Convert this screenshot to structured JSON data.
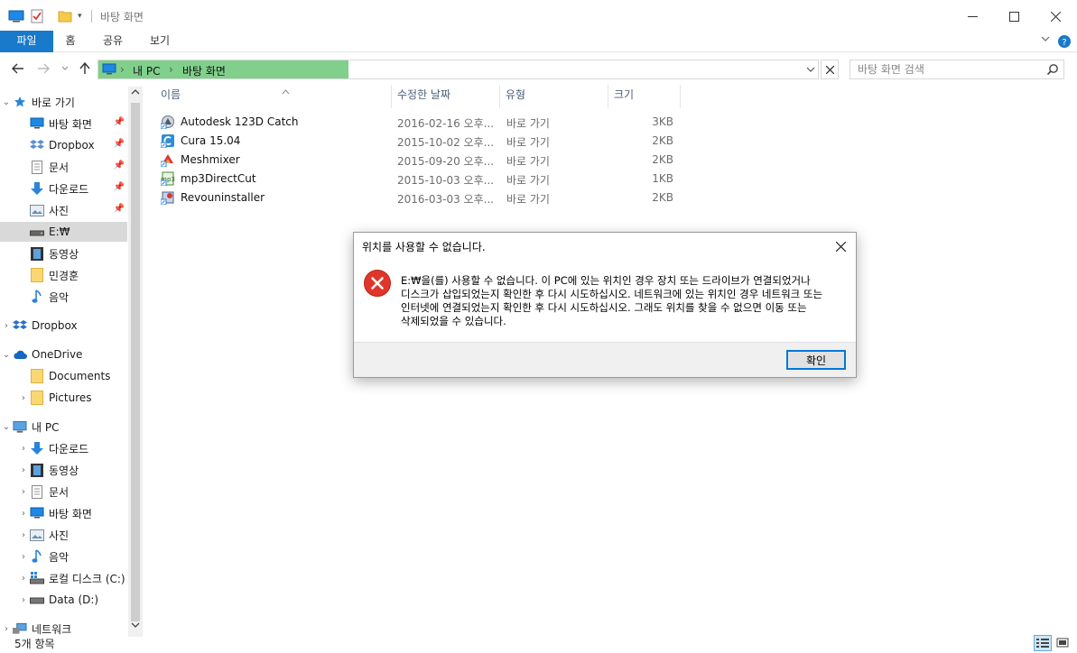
{
  "title": "바탕 화면",
  "ribbon": {
    "tabs": [
      "파일",
      "홈",
      "공유",
      "보기"
    ]
  },
  "address": {
    "crumbs": [
      "내 PC",
      "바탕 화면"
    ],
    "search_placeholder": "바탕 화면 검색"
  },
  "nav": {
    "quick_access": "바로 가기",
    "quick_items": [
      "바탕 화면",
      "Dropbox",
      "문서",
      "다운로드",
      "사진",
      "E:₩",
      "동영상",
      "민경훈",
      "음악"
    ],
    "dropbox": "Dropbox",
    "onedrive": "OneDrive",
    "onedrive_items": [
      "Documents",
      "Pictures"
    ],
    "this_pc": "내 PC",
    "pc_items": [
      "다운로드",
      "동영상",
      "문서",
      "바탕 화면",
      "사진",
      "음악",
      "로컬 디스크 (C:)",
      "Data (D:)"
    ],
    "network": "네트워크"
  },
  "columns": {
    "name": "이름",
    "date": "수정한 날짜",
    "type": "유형",
    "size": "크기"
  },
  "files": [
    {
      "name": "Autodesk 123D Catch",
      "date": "2016-02-16 오후...",
      "type": "바로 가기",
      "size": "3KB"
    },
    {
      "name": "Cura 15.04",
      "date": "2015-10-02 오후...",
      "type": "바로 가기",
      "size": "2KB"
    },
    {
      "name": "Meshmixer",
      "date": "2015-09-20 오후...",
      "type": "바로 가기",
      "size": "2KB"
    },
    {
      "name": "mp3DirectCut",
      "date": "2015-10-03 오후...",
      "type": "바로 가기",
      "size": "1KB"
    },
    {
      "name": "Revouninstaller",
      "date": "2016-03-03 오후...",
      "type": "바로 가기",
      "size": "2KB"
    }
  ],
  "status": {
    "count": "5개 항목"
  },
  "dialog": {
    "title": "위치를 사용할 수 없습니다.",
    "message": "E:₩을(를) 사용할 수 없습니다. 이 PC에 있는 위치인 경우 장치 또는 드라이브가 연결되었거나 디스크가 삽입되었는지 확인한 후 다시 시도하십시오. 네트워크에 있는 위치인 경우 네트워크 또는 인터넷에 연결되었는지 확인한 후 다시 시도하십시오. 그래도 위치를 찾을 수 없으면 이동 또는 삭제되었을 수 있습니다.",
    "ok": "확인"
  },
  "colors": {
    "file_tab": "#1979ca",
    "address_progress": "#80d08c",
    "error_red": "#e0362a"
  }
}
